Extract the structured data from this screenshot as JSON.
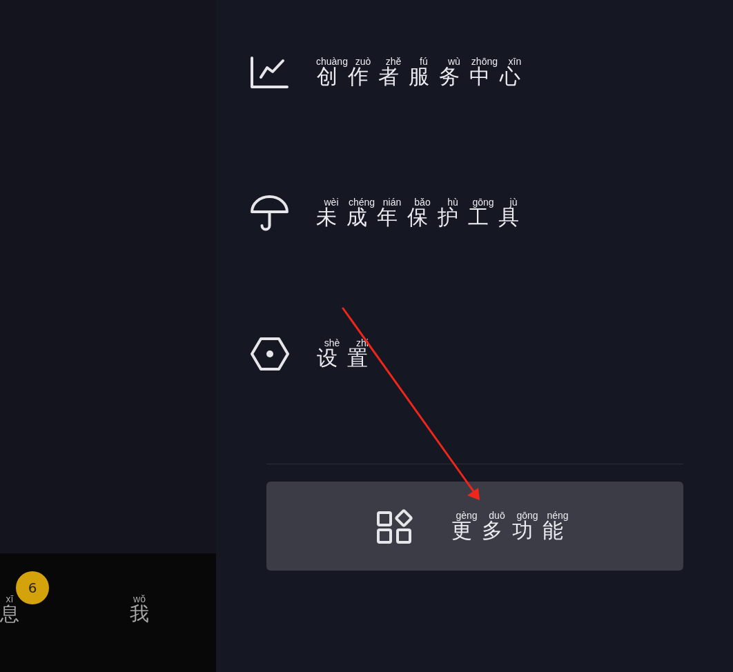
{
  "menu_panel": {
    "items": [
      {
        "label": [
          {
            "hanzi": "创",
            "pinyin": "chuàng"
          },
          {
            "hanzi": "作",
            "pinyin": "zuò"
          },
          {
            "hanzi": "者",
            "pinyin": "zhě"
          },
          {
            "hanzi": "服",
            "pinyin": "fú"
          },
          {
            "hanzi": "务",
            "pinyin": "wù"
          },
          {
            "hanzi": "中",
            "pinyin": "zhōng"
          },
          {
            "hanzi": "心",
            "pinyin": "xīn"
          }
        ]
      },
      {
        "label": [
          {
            "hanzi": "未",
            "pinyin": "wèi"
          },
          {
            "hanzi": "成",
            "pinyin": "chéng"
          },
          {
            "hanzi": "年",
            "pinyin": "nián"
          },
          {
            "hanzi": "保",
            "pinyin": "bǎo"
          },
          {
            "hanzi": "护",
            "pinyin": "hù"
          },
          {
            "hanzi": "工",
            "pinyin": "gōng"
          },
          {
            "hanzi": "具",
            "pinyin": "jù"
          }
        ]
      },
      {
        "label": [
          {
            "hanzi": "设",
            "pinyin": "shè"
          },
          {
            "hanzi": "置",
            "pinyin": "zhi"
          }
        ]
      }
    ],
    "more_button": {
      "label": [
        {
          "hanzi": "更",
          "pinyin": "gèng"
        },
        {
          "hanzi": "多",
          "pinyin": "duō"
        },
        {
          "hanzi": "功",
          "pinyin": "gōng"
        },
        {
          "hanzi": "能",
          "pinyin": "néng"
        }
      ]
    }
  },
  "tab_bar": {
    "tabs": [
      {
        "label": [
          {
            "hanzi": "息",
            "pinyin": "xī"
          }
        ],
        "badge": "6"
      },
      {
        "label": [
          {
            "hanzi": "我",
            "pinyin": "wǒ"
          }
        ]
      }
    ]
  }
}
